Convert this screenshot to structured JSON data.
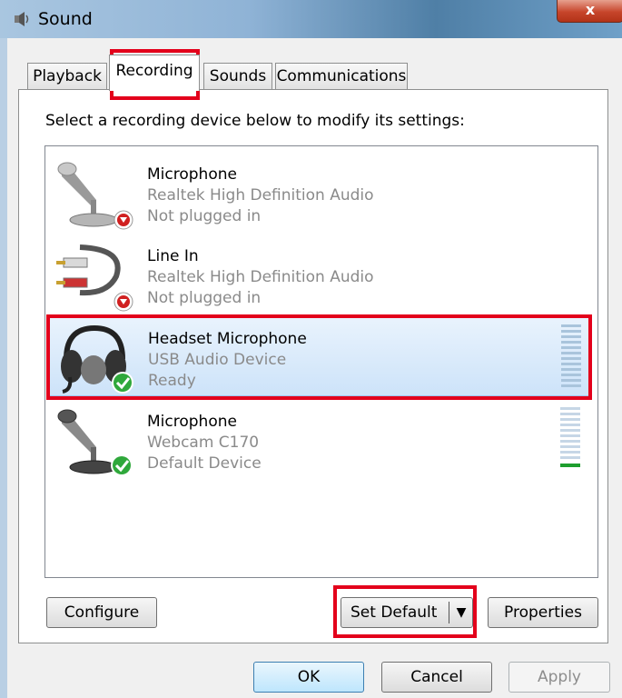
{
  "window": {
    "title": "Sound",
    "close_glyph": "x",
    "icon": "speaker-icon"
  },
  "tabs": [
    {
      "label": "Playback",
      "active": false
    },
    {
      "label": "Recording",
      "active": true
    },
    {
      "label": "Sounds",
      "active": false
    },
    {
      "label": "Communications",
      "active": false
    }
  ],
  "instruction": "Select a recording device below to modify its settings:",
  "devices": [
    {
      "name": "Microphone",
      "driver": "Realtek High Definition Audio",
      "status": "Not plugged in",
      "icon": "microphone-icon",
      "badge": "unplugged-arrow-icon",
      "selected": false
    },
    {
      "name": "Line In",
      "driver": "Realtek High Definition Audio",
      "status": "Not plugged in",
      "icon": "line-in-cable-icon",
      "badge": "unplugged-arrow-icon",
      "selected": false
    },
    {
      "name": "Headset Microphone",
      "driver": "USB Audio Device",
      "status": "Ready",
      "icon": "headset-icon",
      "badge": "check-badge-icon",
      "selected": true
    },
    {
      "name": "Microphone",
      "driver": "Webcam C170",
      "status": "Default Device",
      "icon": "microphone-icon",
      "badge": "check-badge-icon",
      "selected": false
    }
  ],
  "buttons": {
    "configure": "Configure",
    "set_default": "Set Default",
    "properties": "Properties",
    "ok": "OK",
    "cancel": "Cancel",
    "apply": "Apply"
  },
  "colors": {
    "highlight": "#e3001b",
    "selection": "#cde3f9",
    "level_green": "#1e9e2e"
  }
}
